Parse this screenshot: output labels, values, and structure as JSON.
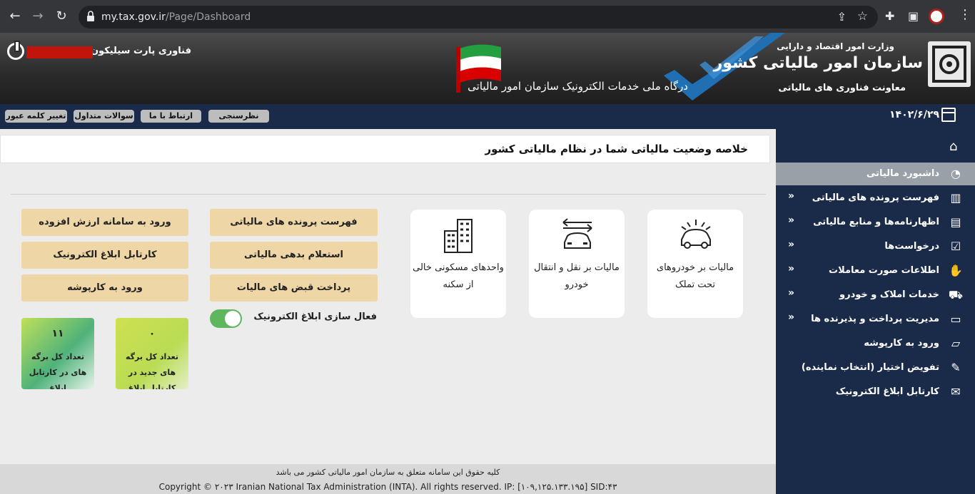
{
  "browser": {
    "url_host": "my.tax.gov.ir",
    "url_path": "/Page/Dashboard",
    "back_icon": "←",
    "forward_icon": "→",
    "reload_icon": "↻",
    "menu_icon": "⋮"
  },
  "header": {
    "ministry": "وزارت امور اقتصاد و دارایی",
    "org_name": "سازمان امور مالیاتی کشور",
    "subtitle": "معاونت فناوری های مالیاتی",
    "portal": "درگاه ملی خدمات الکترونیک سازمان امور مالیاتی",
    "user_name": "فناوری پارت سیلیکون پاژ"
  },
  "topbar": {
    "date": "۱۴۰۲/۶/۲۹",
    "buttons": [
      "نظرسنجی",
      "ارتباط با ما",
      "سوالات متداول",
      "تغییر کلمه عبور"
    ]
  },
  "sidebar": {
    "items": [
      {
        "label": "داشبورد مالیاتی",
        "icon": "dashboard-icon",
        "glyph": "◔",
        "active": true,
        "arrow": ""
      },
      {
        "label": "فهرست پرونده های مالیاتی",
        "icon": "files-icon",
        "glyph": "▥",
        "arrow": "»"
      },
      {
        "label": "اظهارنامه‌ها و منابع مالیاتی",
        "icon": "document-icon",
        "glyph": "▤",
        "arrow": "»"
      },
      {
        "label": "درخواست‌ها",
        "icon": "checklist-icon",
        "glyph": "☑",
        "arrow": "»"
      },
      {
        "label": "اطلاعات صورت معاملات",
        "icon": "handshake-icon",
        "glyph": "✋",
        "arrow": "»"
      },
      {
        "label": "خدمات املاک و خودرو",
        "icon": "car-icon",
        "glyph": "⛟",
        "arrow": "»"
      },
      {
        "label": "مدیریت پرداخت و پذیرنده ها",
        "icon": "card-icon",
        "glyph": "▭",
        "arrow": "»"
      },
      {
        "label": "ورود به کارپوشه",
        "icon": "folder-icon",
        "glyph": "▱",
        "arrow": ""
      },
      {
        "label": "تفویض اختیار (انتخاب نماینده)",
        "icon": "delegate-icon",
        "glyph": "✎",
        "arrow": ""
      },
      {
        "label": "کارتابل ابلاغ الکترونیک",
        "icon": "mail-icon",
        "glyph": "✉",
        "arrow": ""
      }
    ]
  },
  "main": {
    "title": "خلاصه وضعیت مالیاتی شما در نظام مالیاتی کشور",
    "cards": [
      {
        "label": "مالیات بر خودروهای تحت تملک"
      },
      {
        "label": "مالیات بر نقل و انتقال خودرو"
      },
      {
        "label": "واحدهای مسکونی خالی از سکنه"
      }
    ],
    "buttons_col1": [
      "فهرست پرونده های مالیاتی",
      "استعلام بدهی مالیاتی",
      "پرداخت قبض های مالیات"
    ],
    "buttons_col2": [
      "ورود به سامانه ارزش افزوده",
      "کارتابل ابلاغ الکترونیک",
      "ورود به کارپوشه"
    ],
    "toggle_label": "فعال سازی ابلاغ الکترونیک",
    "toggle_on": true,
    "stats": [
      {
        "value": "۰",
        "label": "تعداد کل برگه های جدید در کارتابل ابلاغ"
      },
      {
        "value": "۱۱",
        "label": "تعداد کل برگه های در کارتابل ابلاغ"
      }
    ]
  },
  "footer": {
    "line1": "کلیه حقوق این سامانه متعلق به سازمان امور مالیاتی کشور می باشد",
    "line2": "Copyright © ۲۰۲۳ Iranian National Tax Administration (INTA). All rights reserved. IP: [۱۰۹,۱۲۵.۱۳۳.۱۹۵] SID:۴۳"
  },
  "colors": {
    "navy": "#1a2a49",
    "beige": "#eed6a6",
    "toggle": "#5fb65f"
  }
}
